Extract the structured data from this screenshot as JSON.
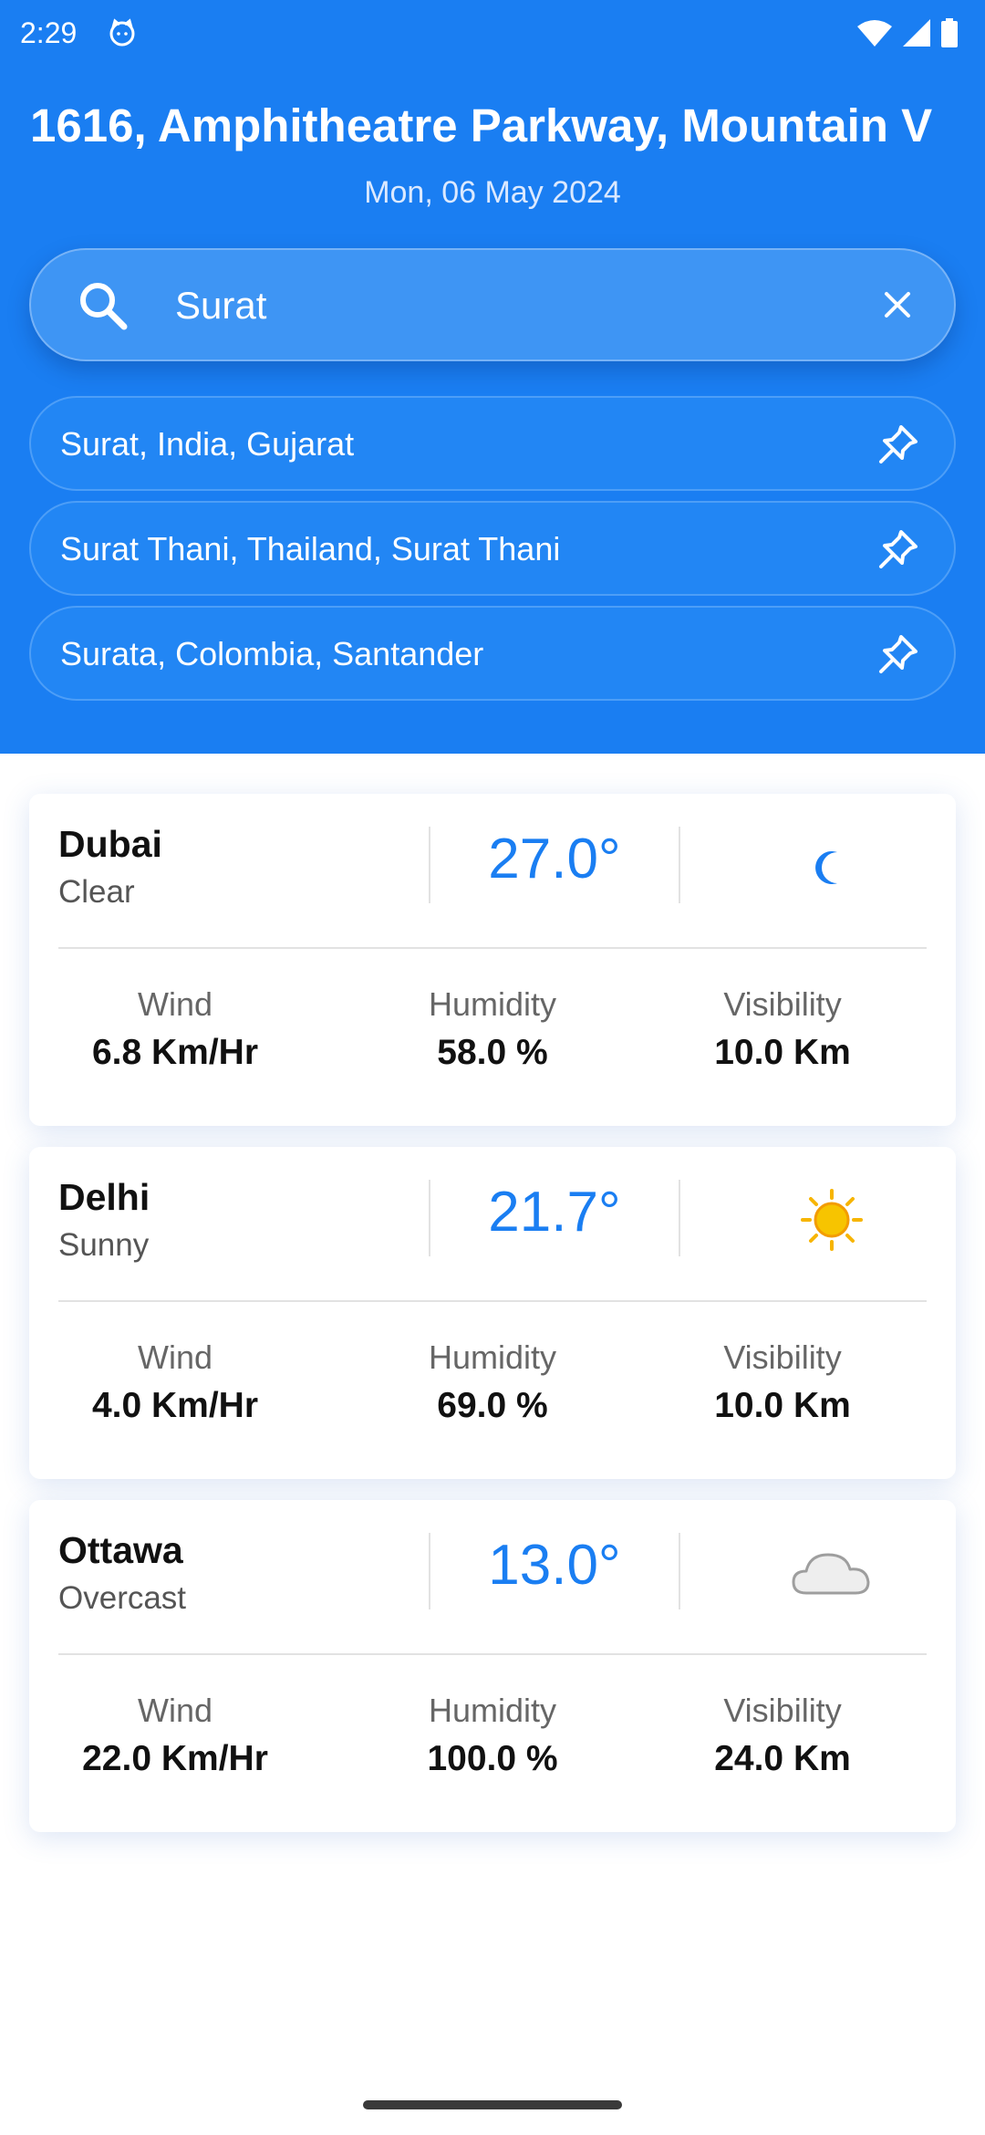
{
  "status_bar": {
    "time": "2:29"
  },
  "header": {
    "location": "1616, Amphitheatre Parkway, Mountain V",
    "date": "Mon, 06 May 2024"
  },
  "search": {
    "value": "Surat"
  },
  "suggestions": [
    {
      "label": "Surat, India, Gujarat"
    },
    {
      "label": "Surat Thani, Thailand, Surat Thani"
    },
    {
      "label": "Surata, Colombia, Santander"
    }
  ],
  "cards": [
    {
      "city": "Dubai",
      "condition": "Clear",
      "temp": "27.0°",
      "icon": "moon-icon",
      "wind_label": "Wind",
      "wind": "6.8 Km/Hr",
      "humidity_label": "Humidity",
      "humidity": "58.0 %",
      "visibility_label": "Visibility",
      "visibility": "10.0 Km"
    },
    {
      "city": "Delhi",
      "condition": "Sunny",
      "temp": "21.7°",
      "icon": "sun-icon",
      "wind_label": "Wind",
      "wind": "4.0 Km/Hr",
      "humidity_label": "Humidity",
      "humidity": "69.0 %",
      "visibility_label": "Visibility",
      "visibility": "10.0 Km"
    },
    {
      "city": "Ottawa",
      "condition": "Overcast",
      "temp": "13.0°",
      "icon": "cloud-icon",
      "wind_label": "Wind",
      "wind": "22.0 Km/Hr",
      "humidity_label": "Humidity",
      "humidity": "100.0 %",
      "visibility_label": "Visibility",
      "visibility": "24.0 Km"
    }
  ],
  "colors": {
    "primary": "#1a7ef2",
    "sun": "#f7b500",
    "cloud": "#9e9e9e"
  }
}
